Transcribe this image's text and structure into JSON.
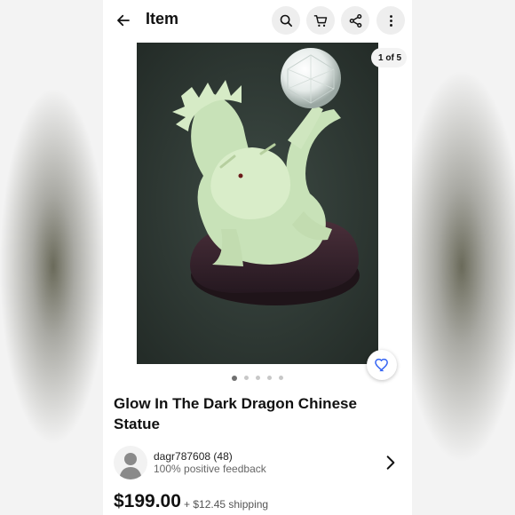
{
  "header": {
    "title": "Item",
    "icons": [
      "arrow-left-icon",
      "search-icon",
      "cart-icon",
      "share-icon",
      "more-vertical-icon"
    ]
  },
  "gallery": {
    "counter": "1 of 5",
    "current_index": 1,
    "total_images": 5,
    "image_description": "jade-green glow in the dark dragon statue holding a clear crystal ball on a dark wooden base"
  },
  "item": {
    "title": "Glow In The Dark Dragon Chinese Statue",
    "price": "$199.00",
    "shipping": "+ $12.45 shipping"
  },
  "seller": {
    "name": "dagr787608 (48)",
    "feedback": "100% positive feedback"
  },
  "colors": {
    "accent": "#3665f3",
    "text": "#111111",
    "secondary_text": "#666666",
    "button_bg": "#eeeeee"
  }
}
